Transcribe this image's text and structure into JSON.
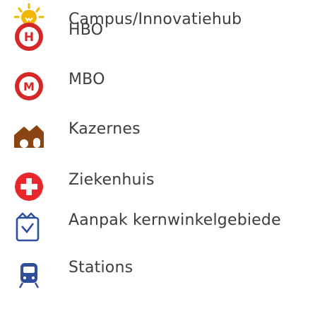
{
  "legend": {
    "items": [
      {
        "icon": "lightbulb-icon",
        "label": "Campus/Innovatiehub",
        "color": "#f2b705"
      },
      {
        "icon": "hbo-school-icon",
        "label": "HBO",
        "color": "#d62728"
      },
      {
        "icon": "mbo-school-icon",
        "label": "MBO",
        "color": "#d62728"
      },
      {
        "icon": "barracks-icon",
        "label": "Kazernes",
        "color": "#8b4513"
      },
      {
        "icon": "hospital-icon",
        "label": "Ziekenhuis",
        "color": "#e8262e"
      },
      {
        "icon": "shopping-area-icon",
        "label": "Aanpak kernwinkelgebiede",
        "color": "#2f4e9c"
      },
      {
        "icon": "station-icon",
        "label": "Stations",
        "color": "#2f4e9c"
      }
    ]
  }
}
